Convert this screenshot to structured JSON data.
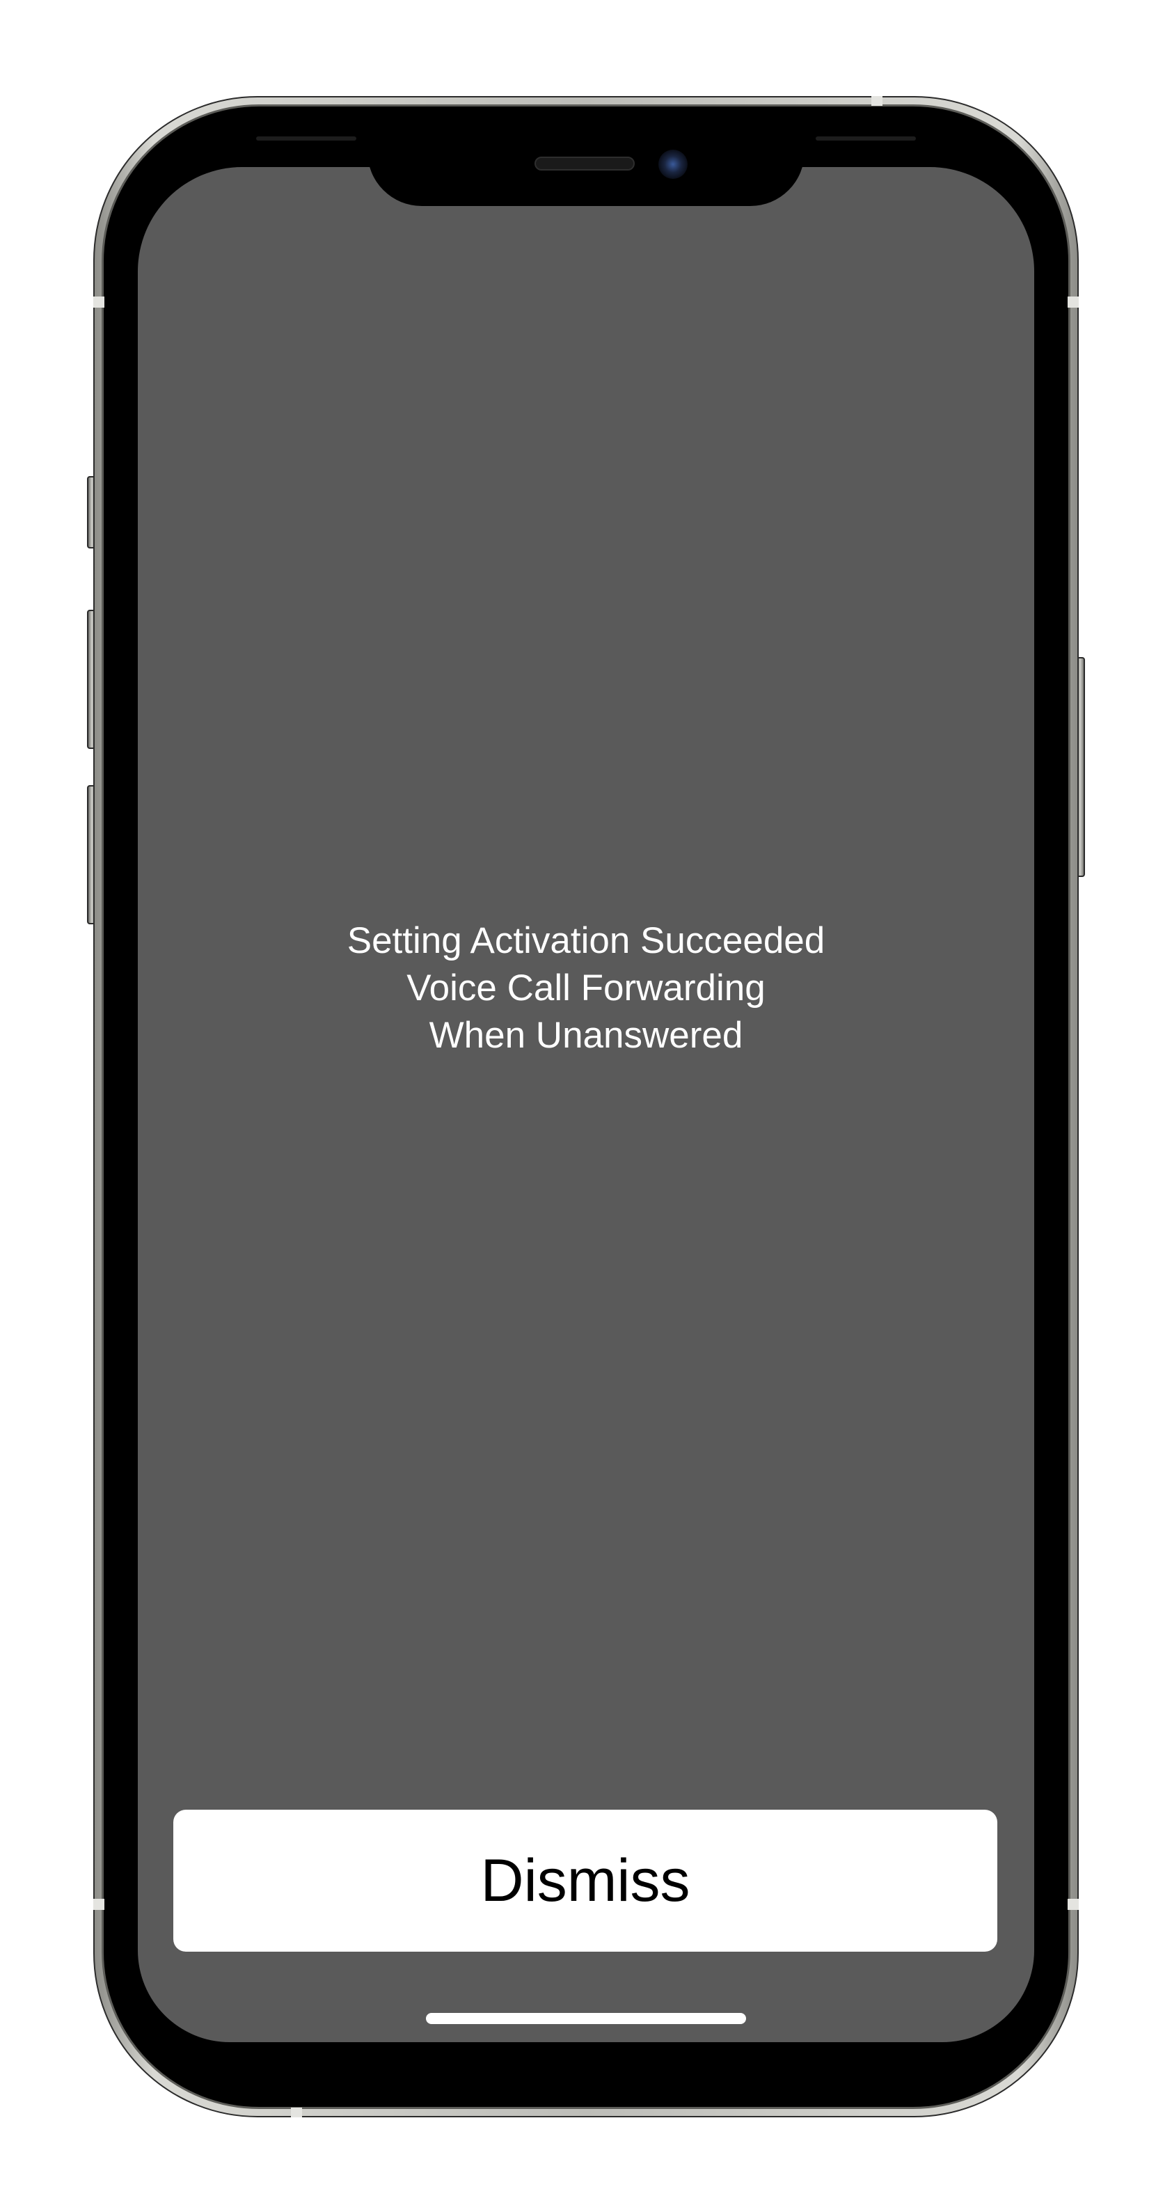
{
  "alert": {
    "line1": "Setting Activation Succeeded",
    "line2": "Voice Call Forwarding",
    "line3": "When Unanswered"
  },
  "actions": {
    "dismiss_label": "Dismiss"
  },
  "colors": {
    "screen_background": "#5a5a5a",
    "button_background": "#ffffff",
    "text_primary": "#ffffff",
    "button_text": "#000000"
  }
}
